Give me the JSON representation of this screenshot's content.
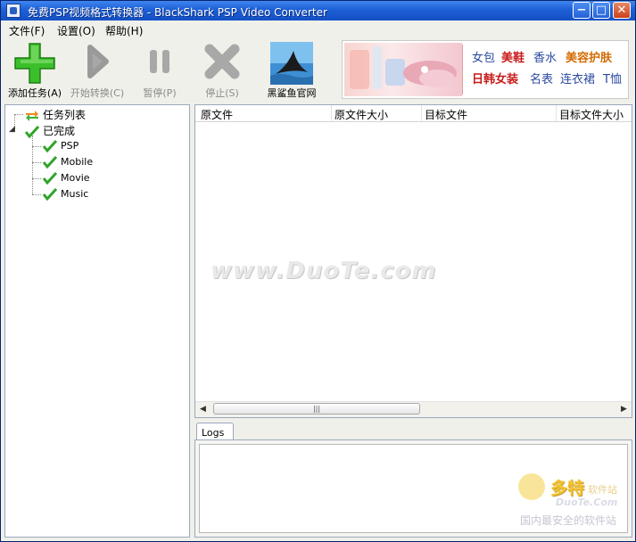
{
  "window": {
    "title": "免费PSP视频格式转换器 - BlackShark PSP Video Converter",
    "min_glyph": "−",
    "max_glyph": "□",
    "close_glyph": "✕"
  },
  "menu": [
    {
      "label": "文件(F)"
    },
    {
      "label": "设置(O)"
    },
    {
      "label": "帮助(H)"
    }
  ],
  "toolbar": {
    "add_label": "添加任务(A)",
    "start_label": "开始转换(C)",
    "pause_label": "暂停(P)",
    "stop_label": "停止(S)",
    "site_label": "黑鲨鱼官网"
  },
  "ad": {
    "links": [
      "女包",
      "美鞋",
      "香水",
      "美容护肤",
      "日韩女装",
      "名表",
      "连衣裙",
      "T恤"
    ],
    "colors": {
      "blue": "#2a4aa0",
      "red": "#c81a1a",
      "orange": "#d46a00"
    }
  },
  "tree": {
    "task_list": "任务列表",
    "completed": "已完成",
    "children": [
      "PSP",
      "Mobile",
      "Movie",
      "Music"
    ]
  },
  "table": {
    "columns": [
      "原文件",
      "原文件大小",
      "目标文件",
      "目标文件大小"
    ],
    "scroll_grip": "|||"
  },
  "watermark": "www.DuoTe.com",
  "logs": {
    "tab_label": "Logs"
  },
  "corner_logo": {
    "brand": "多特",
    "brand_suffix": "软件站",
    "site": "DuoTe.Com",
    "slogan": "国内最安全的软件站"
  }
}
